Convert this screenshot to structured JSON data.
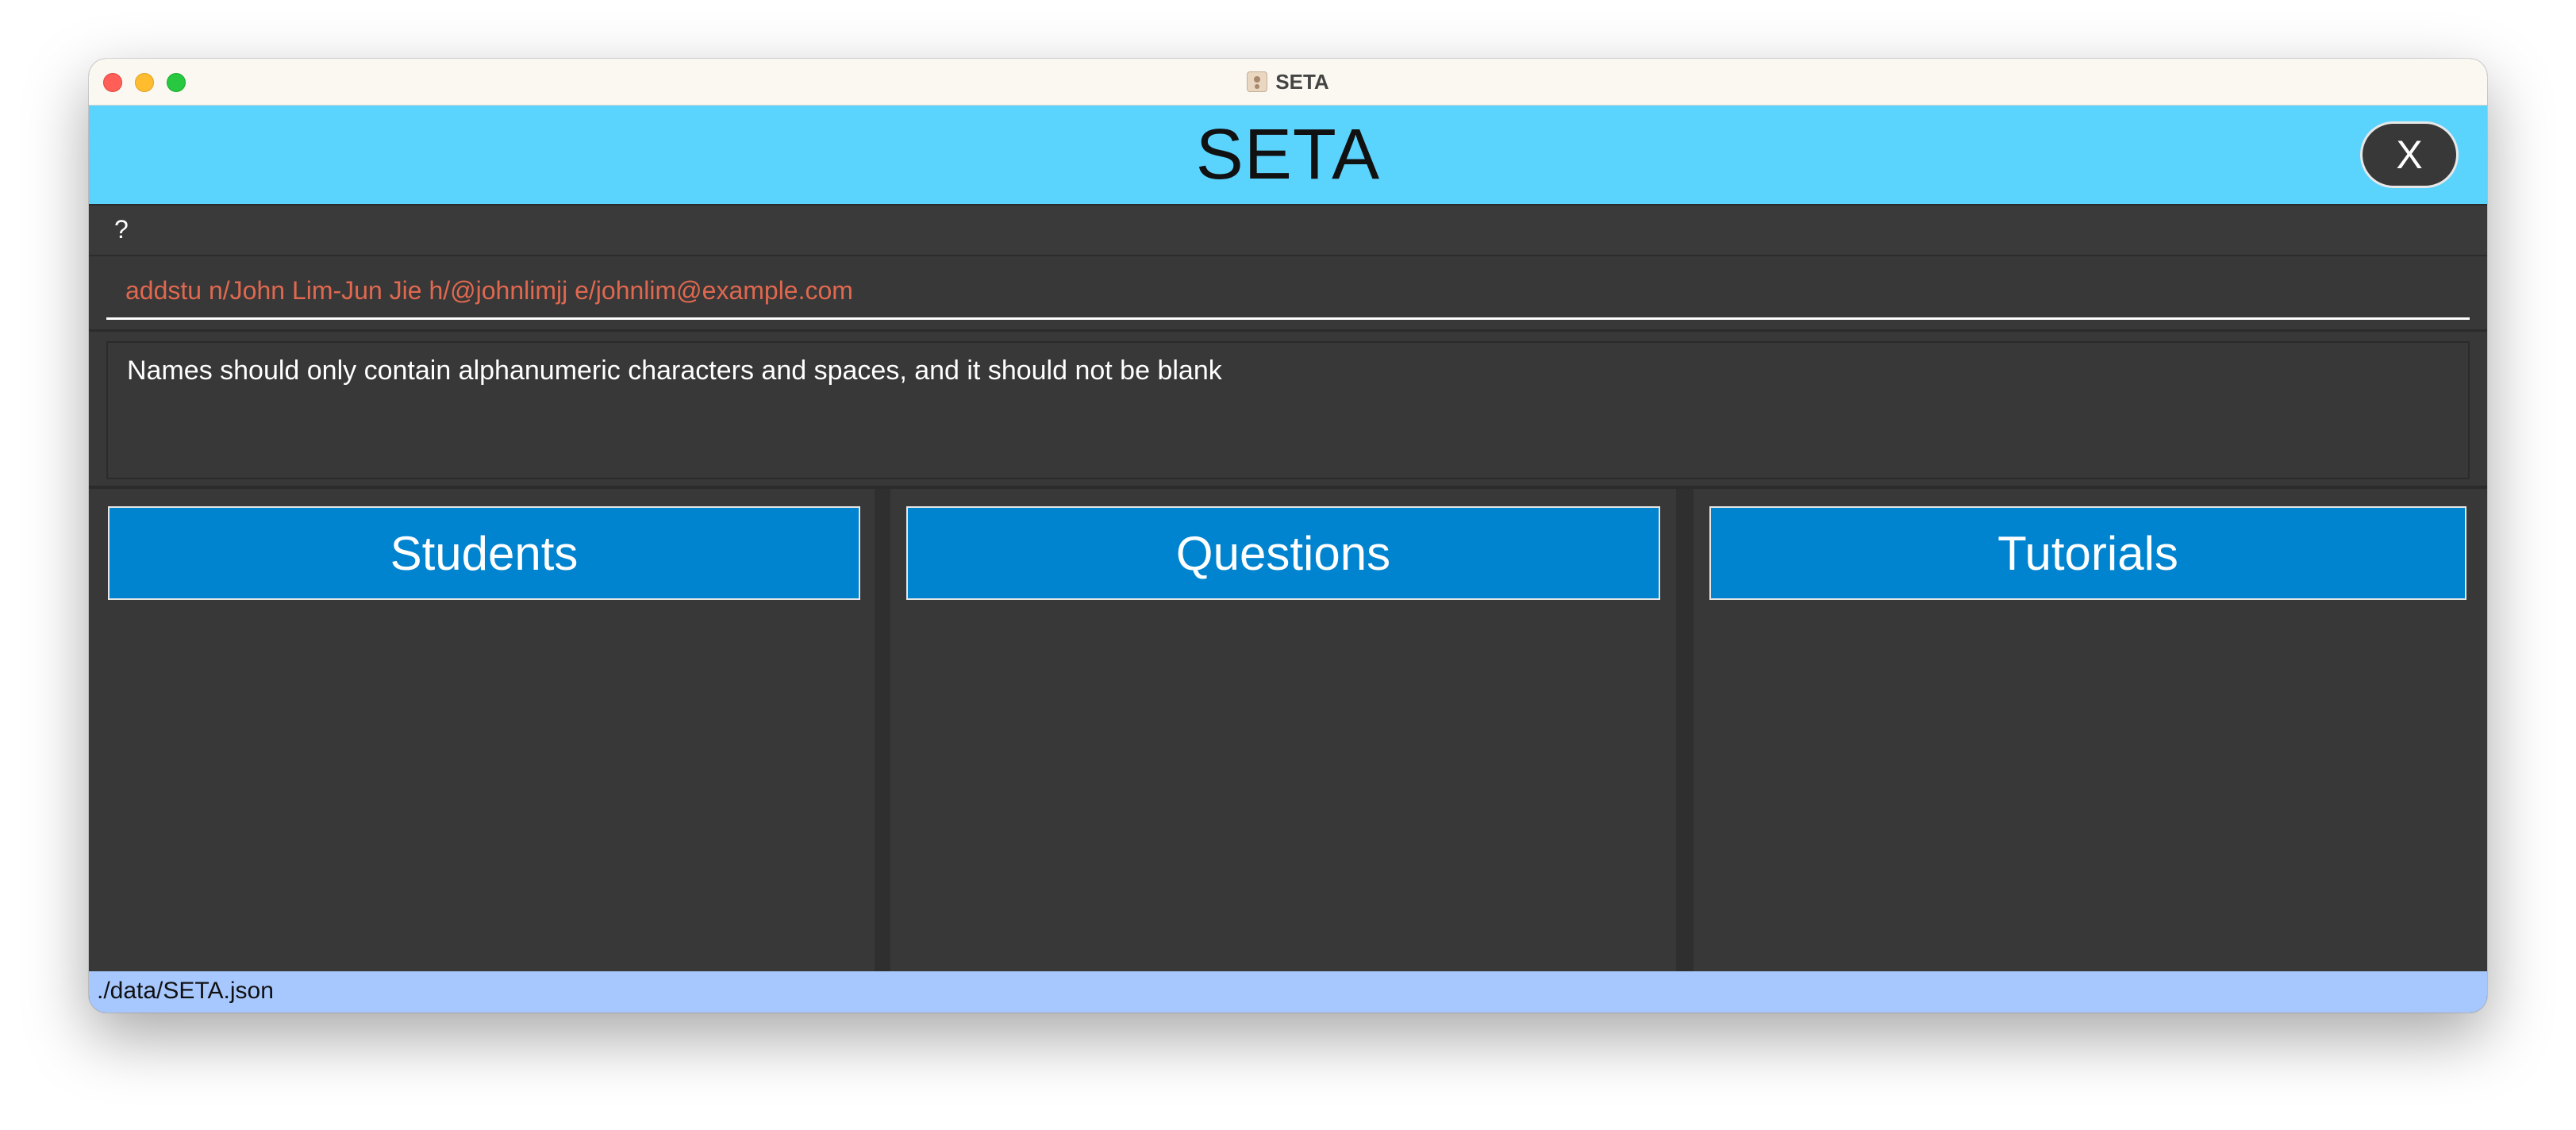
{
  "window": {
    "title": "SETA"
  },
  "header": {
    "title": "SETA",
    "close_label": "X"
  },
  "menu": {
    "help_label": "?"
  },
  "command": {
    "value": "addstu n/John Lim-Jun Jie h/@johnlimjj e/johnlim@example.com"
  },
  "result": {
    "message": "Names should only contain alphanumeric characters and spaces, and it should not be blank"
  },
  "panels": [
    {
      "title": "Students"
    },
    {
      "title": "Questions"
    },
    {
      "title": "Tutorials"
    }
  ],
  "status": {
    "file_path": "./data/SETA.json"
  },
  "colors": {
    "header_bg": "#5ad3fd",
    "panel_header_bg": "#0084d0",
    "command_text": "#e0684f",
    "status_bg": "#a6c8ff",
    "body_bg": "#383838"
  }
}
